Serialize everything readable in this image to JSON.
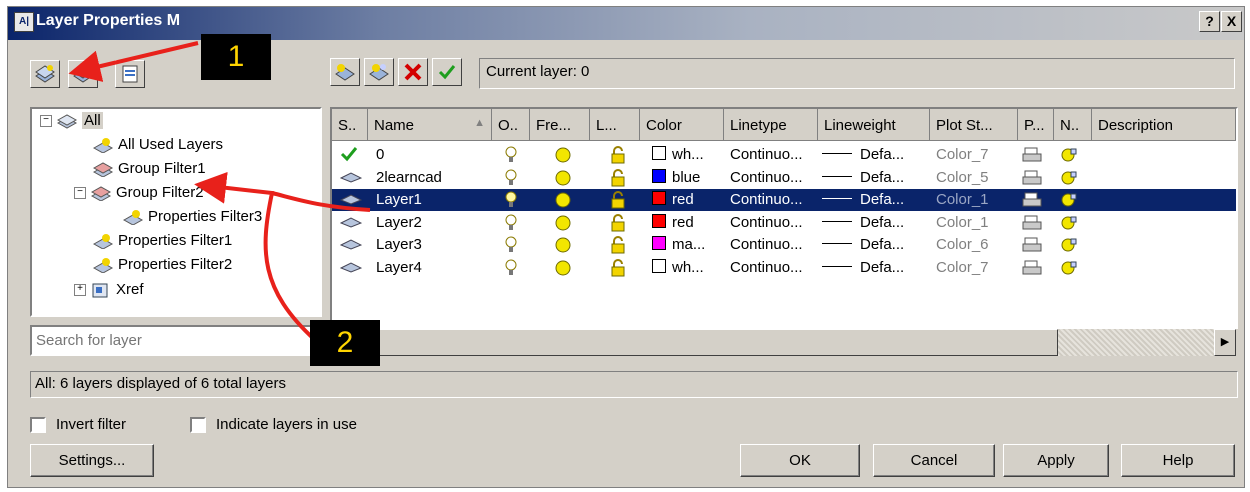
{
  "window": {
    "title": "Layer Properties M",
    "help_btn": "?",
    "close_btn": "X",
    "icon_text": "A|"
  },
  "current_layer": "Current layer: 0",
  "tree": {
    "items": [
      {
        "label": "All"
      },
      {
        "label": "All Used Layers"
      },
      {
        "label": "Group Filter1"
      },
      {
        "label": "Group Filter2"
      },
      {
        "label": "Properties Filter3"
      },
      {
        "label": "Properties Filter1"
      },
      {
        "label": "Properties Filter2"
      },
      {
        "label": "Xref"
      }
    ]
  },
  "search": {
    "placeholder": "Search for layer"
  },
  "columns": [
    "S..",
    "Name",
    "O..",
    "Fre...",
    "L...",
    "Color",
    "Linetype",
    "Lineweight",
    "Plot St...",
    "P...",
    "N..",
    "Description"
  ],
  "layers": [
    {
      "name": "0",
      "color_name": "wh...",
      "color_hex": "#ffffff",
      "linetype": "Continuo...",
      "lineweight": "Defa...",
      "plot_style": "Color_7",
      "current": true
    },
    {
      "name": "2learncad",
      "color_name": "blue",
      "color_hex": "#0000ff",
      "linetype": "Continuo...",
      "lineweight": "Defa...",
      "plot_style": "Color_5",
      "current": false
    },
    {
      "name": "Layer1",
      "color_name": "red",
      "color_hex": "#ff0000",
      "linetype": "Continuo...",
      "lineweight": "Defa...",
      "plot_style": "Color_1",
      "current": false,
      "selected": true
    },
    {
      "name": "Layer2",
      "color_name": "red",
      "color_hex": "#ff0000",
      "linetype": "Continuo...",
      "lineweight": "Defa...",
      "plot_style": "Color_1",
      "current": false
    },
    {
      "name": "Layer3",
      "color_name": "ma...",
      "color_hex": "#ff00ff",
      "linetype": "Continuo...",
      "lineweight": "Defa...",
      "plot_style": "Color_6",
      "current": false
    },
    {
      "name": "Layer4",
      "color_name": "wh...",
      "color_hex": "#ffffff",
      "linetype": "Continuo...",
      "lineweight": "Defa...",
      "plot_style": "Color_7",
      "current": false
    }
  ],
  "status": "All: 6 layers displayed of 6 total layers",
  "options": {
    "invert_filter": "Invert filter",
    "indicate_in_use": "Indicate layers in use"
  },
  "buttons": {
    "settings": "Settings...",
    "ok": "OK",
    "cancel": "Cancel",
    "apply": "Apply",
    "help": "Help"
  },
  "callouts": {
    "one": "1",
    "two": "2"
  },
  "accent": {
    "selection": "#0a246a",
    "annotation": "#e8211b",
    "callout_text": "#ffd400"
  }
}
